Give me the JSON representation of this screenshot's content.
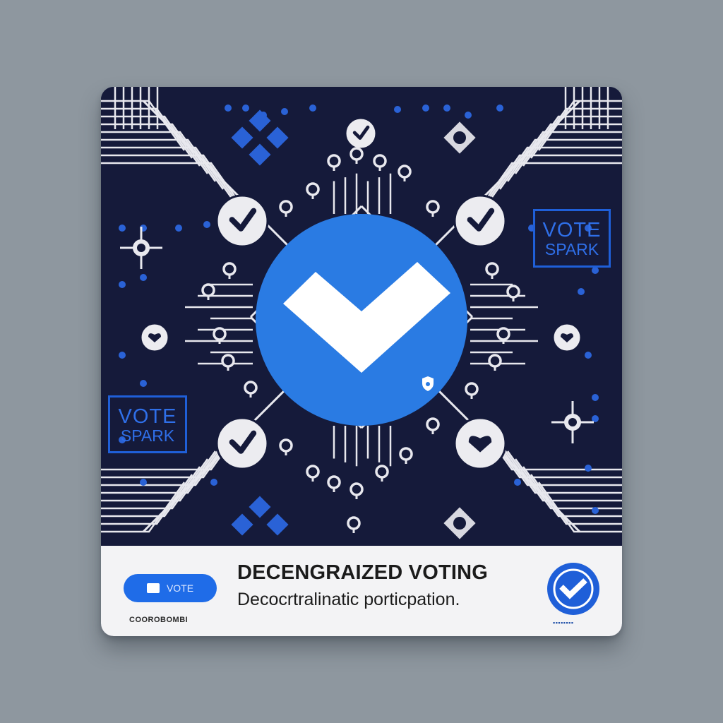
{
  "card": {
    "side_logo": {
      "line1": "VOTE",
      "line2": "SPARK"
    },
    "footer": {
      "vote_button_label": "VOTE",
      "title": "DECENGRAIZED VOTING",
      "subtitle": "Decocrtralinatic porticpation.",
      "small_left_text": "COOROBOMBI",
      "small_right_text": "▪▪▪▪▪▪▪▪"
    }
  },
  "colors": {
    "background": "#8e979f",
    "card_dark": "#151a3a",
    "accent_blue": "#2a7be3",
    "line_white": "#e8e8ee",
    "footer_bg": "#f3f3f5"
  },
  "icons": [
    "checkmark-icon",
    "heart-icon",
    "circuit-node-icon",
    "diamond-tile-icon",
    "shield-icon"
  ]
}
